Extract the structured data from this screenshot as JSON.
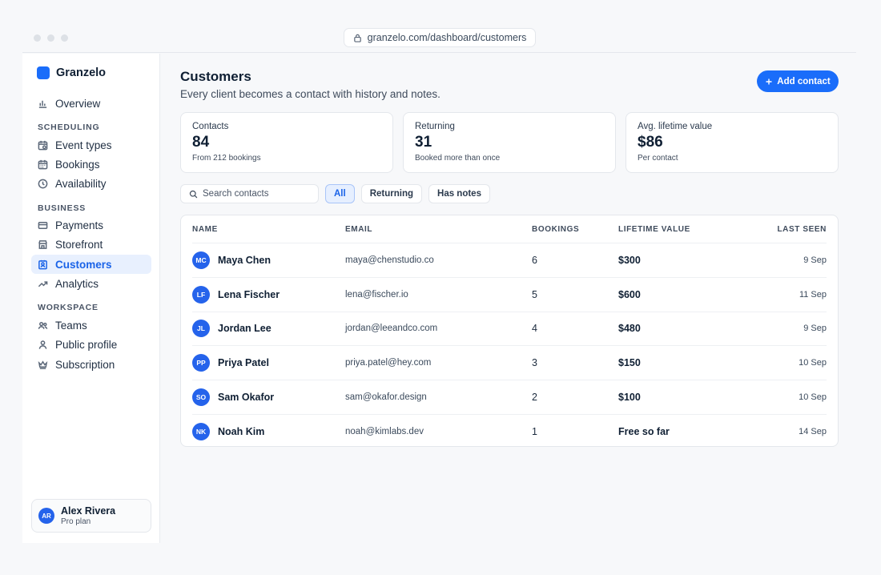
{
  "browser": {
    "url": "granzelo.com/dashboard/customers"
  },
  "brand": {
    "name": "Granzelo",
    "color": "#1a6dfa"
  },
  "sidebar": {
    "overview": "Overview",
    "sections": [
      {
        "label": "SCHEDULING",
        "items": [
          "Event types",
          "Bookings",
          "Availability"
        ]
      },
      {
        "label": "BUSINESS",
        "items": [
          "Payments",
          "Storefront",
          "Customers",
          "Analytics"
        ]
      },
      {
        "label": "WORKSPACE",
        "items": [
          "Teams",
          "Public profile",
          "Subscription"
        ]
      }
    ],
    "active": "Customers",
    "user": {
      "initials": "AR",
      "name": "Alex Rivera",
      "plan": "Pro plan"
    }
  },
  "header": {
    "title": "Customers",
    "subtitle": "Every client becomes a contact with history and notes.",
    "add_button": "Add contact"
  },
  "stats": [
    {
      "label": "Contacts",
      "value": "84",
      "note": "From 212 bookings"
    },
    {
      "label": "Returning",
      "value": "31",
      "note": "Booked more than once"
    },
    {
      "label": "Avg. lifetime value",
      "value": "$86",
      "note": "Per contact"
    }
  ],
  "filters": {
    "search_placeholder": "Search contacts",
    "chips": [
      "All",
      "Returning",
      "Has notes"
    ],
    "active": "All"
  },
  "table": {
    "columns": [
      "NAME",
      "EMAIL",
      "BOOKINGS",
      "LIFETIME VALUE",
      "LAST SEEN"
    ],
    "rows": [
      {
        "initials": "MC",
        "name": "Maya Chen",
        "email": "maya@chenstudio.co",
        "bookings": "6",
        "lifetime": "$300",
        "last_seen": "9 Sep"
      },
      {
        "initials": "LF",
        "name": "Lena Fischer",
        "email": "lena@fischer.io",
        "bookings": "5",
        "lifetime": "$600",
        "last_seen": "11 Sep"
      },
      {
        "initials": "JL",
        "name": "Jordan Lee",
        "email": "jordan@leeandco.com",
        "bookings": "4",
        "lifetime": "$480",
        "last_seen": "9 Sep"
      },
      {
        "initials": "PP",
        "name": "Priya Patel",
        "email": "priya.patel@hey.com",
        "bookings": "3",
        "lifetime": "$150",
        "last_seen": "10 Sep"
      },
      {
        "initials": "SO",
        "name": "Sam Okafor",
        "email": "sam@okafor.design",
        "bookings": "2",
        "lifetime": "$100",
        "last_seen": "10 Sep"
      },
      {
        "initials": "NK",
        "name": "Noah Kim",
        "email": "noah@kimlabs.dev",
        "bookings": "1",
        "lifetime": "Free so far",
        "last_seen": "14 Sep"
      }
    ]
  },
  "icons": {
    "overview": "bar-chart-icon",
    "event_types": "calendar-clock-icon",
    "bookings": "calendar-icon",
    "availability": "clock-icon",
    "payments": "credit-card-icon",
    "storefront": "store-icon",
    "customers": "contact-card-icon",
    "analytics": "trending-up-icon",
    "teams": "users-icon",
    "public_profile": "user-icon",
    "subscription": "crown-icon"
  }
}
